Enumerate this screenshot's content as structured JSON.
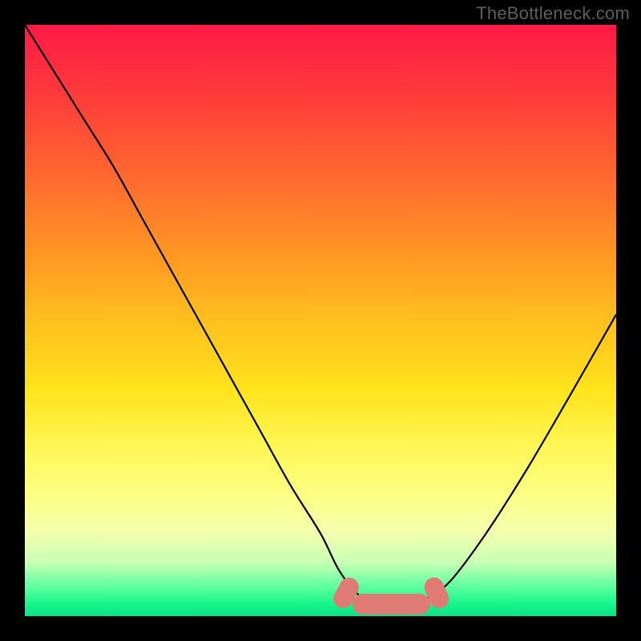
{
  "watermark": "TheBottleneck.com",
  "colors": {
    "page_bg": "#000000",
    "curve": "#000000",
    "marker": "#e07a74",
    "gradient_top": "#ff1a46",
    "gradient_bottom": "#0de085"
  },
  "chart_data": {
    "type": "line",
    "title": "",
    "xlabel": "",
    "ylabel": "",
    "xlim": [
      0,
      100
    ],
    "ylim": [
      0,
      100
    ],
    "x": [
      0,
      5,
      10,
      15,
      20,
      25,
      30,
      35,
      40,
      45,
      50,
      53,
      56,
      59,
      62,
      65,
      68,
      72,
      78,
      85,
      92,
      100
    ],
    "values": [
      100,
      92,
      84,
      76,
      67,
      58,
      49,
      40,
      31,
      22,
      14,
      8,
      4,
      2,
      2,
      2,
      3,
      6,
      14,
      25,
      37,
      51
    ],
    "valley": {
      "x_range": [
        56,
        68
      ],
      "y": 2
    },
    "grid": false,
    "legend": false
  }
}
